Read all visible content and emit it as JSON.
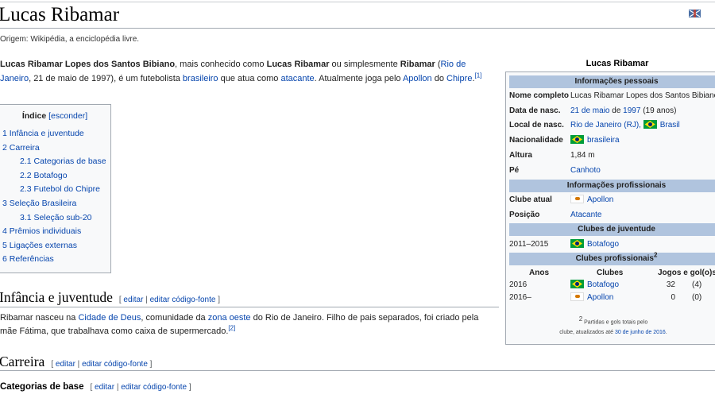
{
  "page": {
    "title": "Lucas Ribamar",
    "origin": "Origem: Wikipédia, a enciclopédia livre."
  },
  "intro": {
    "name_bold": "Lucas Ribamar Lopes dos Santos Bibiano",
    "t1": ", mais conhecido como ",
    "known_bold": "Lucas Ribamar",
    "t2": " ou simplesmente ",
    "simple_bold": "Ribamar",
    "t3": " (",
    "link_city": "Rio de Janeiro",
    "t4": ", 21 de maio de 1997), é um futebolista ",
    "link_nat": "brasileiro",
    "t5": " que atua como ",
    "link_pos": "atacante",
    "t6": ". Atualmente joga pelo ",
    "link_club": "Apollon",
    "t7": " do ",
    "link_country": "Chipre",
    "t8": ".",
    "ref": "[1]"
  },
  "toc": {
    "title": "Índice",
    "toggle": "[esconder]",
    "items": [
      {
        "num": "1",
        "label": "Infância e juventude"
      },
      {
        "num": "2",
        "label": "Carreira"
      },
      {
        "num": "2.1",
        "label": "Categorias de base"
      },
      {
        "num": "2.2",
        "label": "Botafogo"
      },
      {
        "num": "2.3",
        "label": "Futebol do Chipre"
      },
      {
        "num": "3",
        "label": "Seleção Brasileira"
      },
      {
        "num": "3.1",
        "label": "Seleção sub-20"
      },
      {
        "num": "4",
        "label": "Prêmios individuais"
      },
      {
        "num": "5",
        "label": "Ligações externas"
      },
      {
        "num": "6",
        "label": "Referências"
      }
    ]
  },
  "sections": {
    "s1_title": "Infância e juventude",
    "edit_open": "[ ",
    "edit": "editar",
    "sep": " | ",
    "edit_source": "editar código-fonte",
    "edit_close": " ]",
    "s1_t1": "Ribamar nasceu na ",
    "s1_link1": "Cidade de Deus",
    "s1_t2": ", comunidade da ",
    "s1_link2": "zona oeste",
    "s1_t3": " do Rio de Janeiro. Filho de pais separados, foi criado pela mãe Fátima, que trabalhava como caixa de supermercado.",
    "s1_ref": "[2]",
    "s2_title": "Carreira",
    "s3_title": "Categorias de base"
  },
  "infobox": {
    "title": "Lucas Ribamar",
    "personal_header": "Informações pessoais",
    "full_name_label": "Nome completo",
    "full_name": "Lucas Ribamar Lopes dos Santos Bibiano",
    "birth_label": "Data de nasc.",
    "birth_day": "21 de maio",
    "birth_de": " de ",
    "birth_year": "1997",
    "birth_age": " (19 anos)",
    "place_label": "Local de nasc.",
    "place_city": "Rio de Janeiro (RJ),",
    "place_country": "Brasil",
    "nationality_label": "Nacionalidade",
    "nationality": "brasileira",
    "height_label": "Altura",
    "height": "1,84 m",
    "foot_label": "Pé",
    "foot": "Canhoto",
    "pro_header": "Informações profissionais",
    "club_label": "Clube atual",
    "club": "Apollon",
    "position_label": "Posição",
    "position": "Atacante",
    "youth_header": "Clubes de juventude",
    "youth_years": "2011–2015",
    "youth_club": "Botafogo",
    "pro_clubs_header": "Clubes profissionais",
    "pro_clubs_sup": "2",
    "col_years": "Anos",
    "col_clubs": "Clubes",
    "col_apps": "Jogos e gol(o)s",
    "rows": [
      {
        "years": "2016",
        "club": "Botafogo",
        "apps": "32",
        "goals": "(4)",
        "flag": "br"
      },
      {
        "years": "2016–",
        "club": "Apollon",
        "apps": "0",
        "goals": "(0)",
        "flag": "cy"
      }
    ],
    "footnote_sup": "2",
    "footnote_1": " Partidas e gols totais pelo",
    "footnote_2": "clube, atualizados até ",
    "footnote_date": "30 de junho de 2016",
    "footnote_end": "."
  }
}
